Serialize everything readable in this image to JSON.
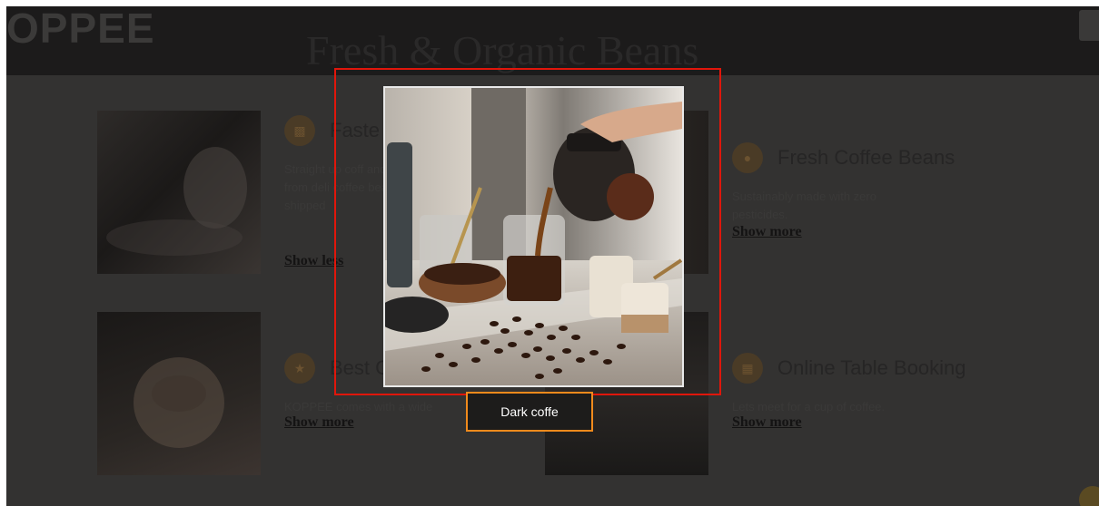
{
  "brand": {
    "logo": "OPPEE"
  },
  "hero": {
    "title": "Fresh & Organic Beans"
  },
  "features": [
    {
      "title": "Faste",
      "desc": "Straight up coff and treats wor Made from deli coffee beans, th they're shipped",
      "link": "Show less"
    },
    {
      "title": "Fresh Coffee Beans",
      "desc": "Sustainably made with zero pesticides.",
      "link": "Show more"
    },
    {
      "title": "Best C",
      "desc": "KOPPEE comes with a wide",
      "link": "Show more"
    },
    {
      "title": "Online Table Booking",
      "desc": "Lets meet for a cup of coffee.",
      "link": "Show more"
    }
  ],
  "lightbox": {
    "caption": "Dark coffe"
  },
  "colors": {
    "highlight": "#e0160b",
    "caption_border": "#f08a1c",
    "overlay": "#333231"
  }
}
